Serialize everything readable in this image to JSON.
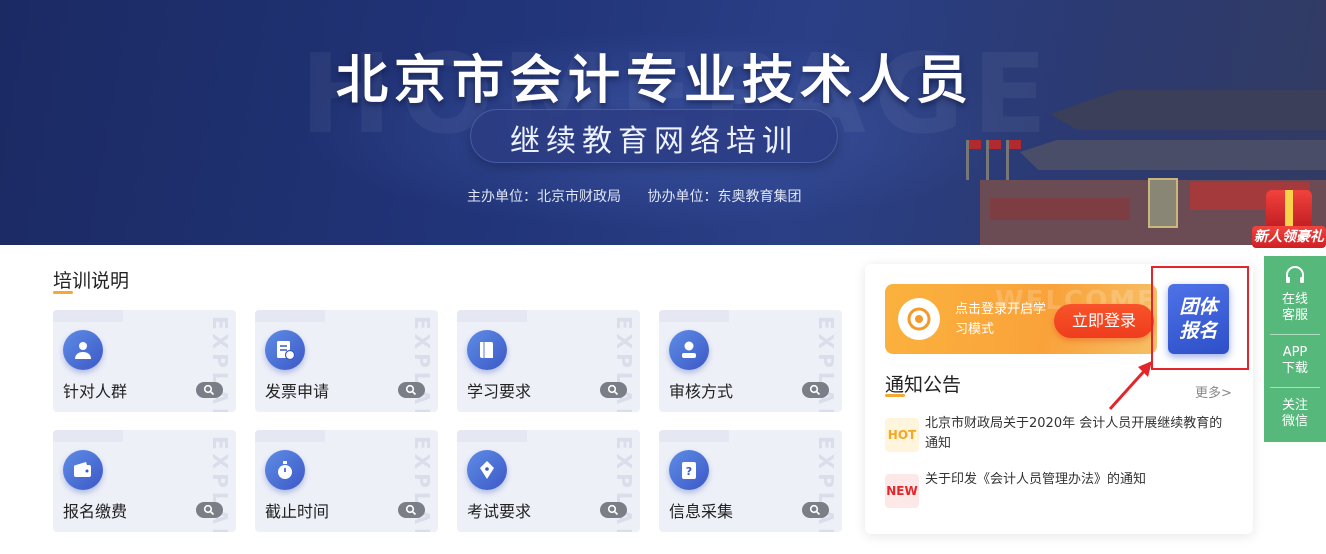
{
  "banner": {
    "title": "北京市会计专业技术人员",
    "subtitle": "继续教育网络培训",
    "host": "主办单位：北京市财政局",
    "co_host": "协办单位：东奥教育集团",
    "watermark": "HOMEPAGE"
  },
  "gift_badge": {
    "label": "新人领豪礼"
  },
  "training": {
    "title": "培训说明",
    "cards": [
      {
        "label": "针对人群",
        "icon": "people-icon"
      },
      {
        "label": "发票申请",
        "icon": "invoice-icon"
      },
      {
        "label": "学习要求",
        "icon": "book-icon"
      },
      {
        "label": "审核方式",
        "icon": "user-check-icon"
      },
      {
        "label": "报名缴费",
        "icon": "wallet-icon"
      },
      {
        "label": "截止时间",
        "icon": "stopwatch-icon"
      },
      {
        "label": "考试要求",
        "icon": "pen-icon"
      },
      {
        "label": "信息采集",
        "icon": "question-clipboard-icon"
      }
    ],
    "card_watermark": "EXPLAIN"
  },
  "login_card": {
    "prompt": "点击登录开启学习模式",
    "button": "立即登录",
    "watermark": "WELCOME"
  },
  "group_signup": {
    "line1": "团体",
    "line2": "报名"
  },
  "notices": {
    "title": "通知公告",
    "more": "更多>",
    "items": [
      {
        "tag": "HOT",
        "text": "北京市财政局关于2020年 会计人员开展继续教育的通知"
      },
      {
        "tag": "NEW",
        "text": "关于印发《会计人员管理办法》的通知"
      }
    ]
  },
  "sidebar": {
    "items": [
      {
        "label_line1": "在线",
        "label_line2": "客服"
      },
      {
        "label_line1": "APP",
        "label_line2": "下载"
      },
      {
        "label_line1": "关注",
        "label_line2": "微信"
      }
    ]
  },
  "colors": {
    "banner_bg": "#22357a",
    "accent_orange": "#f9a23a",
    "login_button": "#ee3d1d",
    "group_button": "#3a5ed6",
    "sidebar_green": "#57b87b",
    "highlight_red": "#e3262c"
  }
}
